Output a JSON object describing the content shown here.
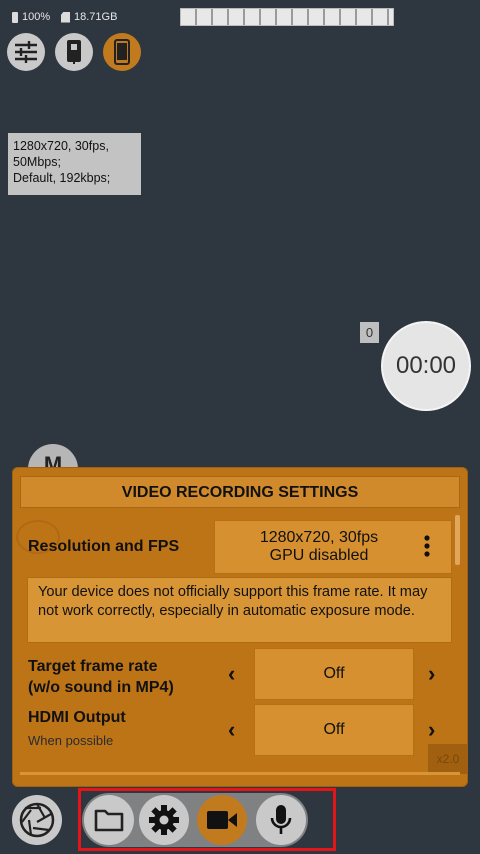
{
  "status_bar": {
    "battery": "100%",
    "storage": "18.71GB"
  },
  "icons": {
    "settings_sliders": "sliders-icon",
    "phone_storage": "phone-storage-icon",
    "phone_orientation": "phone-icon",
    "shutter": "shutter-icon",
    "folder": "folder-icon",
    "gear": "gear-icon",
    "video": "video-camera-icon",
    "mic": "microphone-icon"
  },
  "info_box": {
    "line1": "1280x720, 30fps,",
    "line2": "50Mbps;",
    "line3": "Default, 192kbps;"
  },
  "overlay": {
    "counter": "0",
    "timer": "00:00",
    "mode_letter": "M",
    "zoom": "x2.0"
  },
  "panel": {
    "title": "VIDEO RECORDING SETTINGS",
    "resolution": {
      "label": "Resolution and FPS",
      "value_line1": "1280x720, 30fps",
      "value_line2": "GPU disabled"
    },
    "note": "Your device does not officially support this frame rate. It may not work correctly, especially in automatic exposure mode.",
    "target_rate": {
      "label_line1": "Target frame rate",
      "label_line2": "(w/o sound in MP4)",
      "value": "Off"
    },
    "hdmi": {
      "label": "HDMI Output",
      "sublabel": "When possible",
      "value": "Off"
    }
  },
  "colors": {
    "background": "#2e3740",
    "accent_orange": "#c27a1e",
    "panel": "#bd7417",
    "highlight": "#e3141a"
  }
}
